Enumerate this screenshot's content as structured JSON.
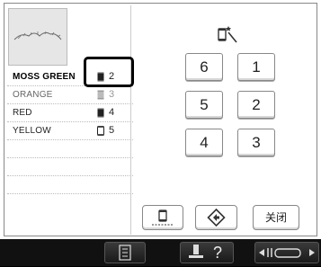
{
  "thread_list": [
    {
      "name": "MOSS GREEN",
      "number": "2",
      "selected": true,
      "color": "#5a7a3a"
    },
    {
      "name": "ORANGE",
      "number": "3",
      "muted": true,
      "color": "#ff8a1a"
    },
    {
      "name": "RED",
      "number": "4",
      "color": "#cc1f1f"
    },
    {
      "name": "YELLOW",
      "number": "5",
      "color": "#f2d21a"
    }
  ],
  "keypad": {
    "k6": "6",
    "k1": "1",
    "k5": "5",
    "k2": "2",
    "k4": "4",
    "k3": "3"
  },
  "buttons": {
    "close_label": "关闭"
  },
  "bottom_bar": {
    "help_glyph": "?",
    "icons": [
      "list-icon",
      "spool-help-icon",
      "arrow-thread-icon"
    ]
  },
  "colors": {
    "selection_outline": "#000000",
    "preview_bg": "#e6e6e6",
    "bottom_bar_bg": "#111111"
  }
}
